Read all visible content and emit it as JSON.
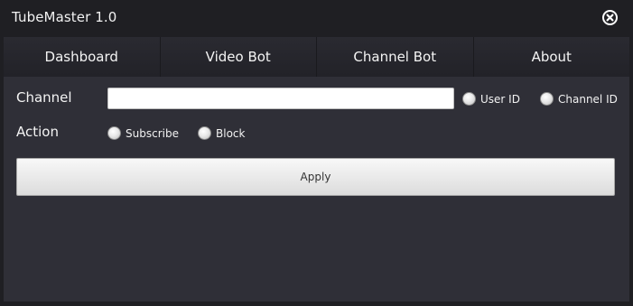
{
  "window": {
    "title": "TubeMaster 1.0"
  },
  "tabs": [
    {
      "label": "Dashboard"
    },
    {
      "label": "Video Bot"
    },
    {
      "label": "Channel Bot"
    },
    {
      "label": "About"
    }
  ],
  "form": {
    "channel_label": "Channel",
    "channel_value": "",
    "channel_placeholder": "",
    "id_type_options": [
      {
        "label": "User ID",
        "selected": false
      },
      {
        "label": "Channel ID",
        "selected": false
      }
    ],
    "action_label": "Action",
    "action_options": [
      {
        "label": "Subscribe",
        "selected": false
      },
      {
        "label": "Block",
        "selected": false
      }
    ],
    "apply_label": "Apply"
  },
  "icons": {
    "close": "close-circle-icon",
    "radio": "radio-unchecked-icon"
  },
  "colors": {
    "titlebar_bg": "#1f1f23",
    "panel_bg": "#2f2f37",
    "tab_bg": "#25252b",
    "text": "#f4f4f4"
  }
}
